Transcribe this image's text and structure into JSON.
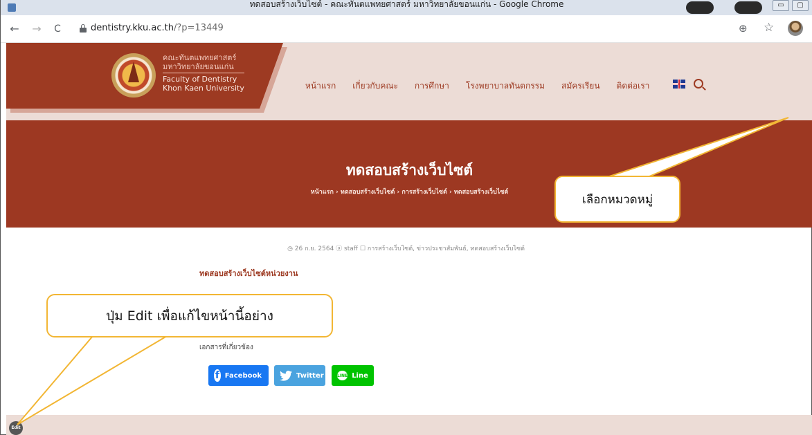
{
  "browser": {
    "window_title": "ทดสอบสร้างเว็บไซต์ - คณะทันตแพทยศาสตร์ มหาวิทยาลัยขอนแก่น - Google Chrome",
    "url_host": "dentistry.kku.ac.th",
    "url_path": "/?p=13449",
    "nav": {
      "back_icon": "←",
      "forward_icon": "→",
      "reload_icon": "C"
    },
    "zoom_icon": "⊕",
    "star_icon": "☆"
  },
  "site": {
    "logo": {
      "line1": "คณะทันตแพทยศาสตร์",
      "line2": "มหาวิทยาลัยขอนแก่น",
      "line3": "Faculty of Dentistry",
      "line4": "Khon Kaen University"
    },
    "menu": [
      {
        "label": "หน้าแรก"
      },
      {
        "label": "เกี่ยวกับคณะ"
      },
      {
        "label": "การศึกษา"
      },
      {
        "label": "โรงพยาบาลทันตกรรม"
      },
      {
        "label": "สมัครเรียน"
      },
      {
        "label": "ติดต่อเรา"
      }
    ]
  },
  "hero": {
    "title": "ทดสอบสร้างเว็บไซต์",
    "breadcrumb": "หน้าแรก › ทดสอบสร้างเว็บไซต์ › การสร้างเว็บไซต์ › ทดสอบสร้างเว็บไซต์"
  },
  "post": {
    "meta": "◷ 26 ก.ย. 2564   ⓐ staff   ☐ การสร้างเว็บไซต์, ข่าวประชาสัมพันธ์, ทดสอบสร้างเว็บไซต์",
    "heading": "ทดสอบสร้างเว็บไซต์หน่วยงาน",
    "docs_label": "เอกสารที่เกี่ยวข้อง",
    "share": {
      "facebook": "Facebook",
      "twitter": "Twitter",
      "line": "Line"
    },
    "edit_label": "Edit"
  },
  "annotations": {
    "category_callout": "เลือกหมวดหมู่",
    "edit_callout": "ปุ่ม Edit เพื่อแก้ไขหน้านี้อย่าง"
  },
  "colors": {
    "brand": "#9d3a22",
    "header_bg": "#ecdcd6",
    "callout_border": "#f2b634"
  }
}
